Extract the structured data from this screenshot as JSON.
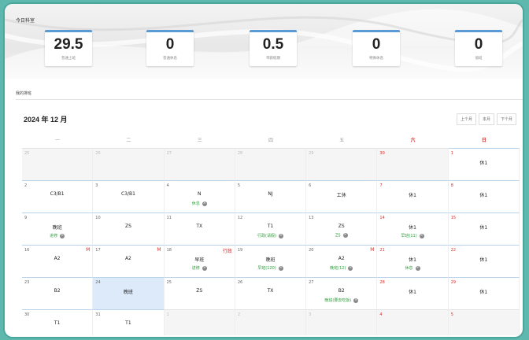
{
  "summary": {
    "title": "今日科室",
    "stats": [
      {
        "value": "29.5",
        "label": "普通上班"
      },
      {
        "value": "0",
        "label": "普通休息"
      },
      {
        "value": "0.5",
        "label": "带薪假期"
      },
      {
        "value": "0",
        "label": "特殊休息"
      },
      {
        "value": "0",
        "label": "值班"
      }
    ]
  },
  "schedule": {
    "section_label": "我的排班",
    "month_title": "2024 年 12 月",
    "nav": [
      "上个月",
      "本月",
      "下个月"
    ],
    "weekdays": [
      "一",
      "二",
      "三",
      "四",
      "五",
      "六",
      "日"
    ],
    "weeks": [
      [
        {
          "day": "25",
          "other": true
        },
        {
          "day": "26",
          "other": true
        },
        {
          "day": "27",
          "other": true
        },
        {
          "day": "28",
          "other": true
        },
        {
          "day": "29",
          "other": true
        },
        {
          "day": "30",
          "other": true,
          "weekend": true
        },
        {
          "day": "1",
          "weekend": true,
          "shift": "休1"
        }
      ],
      [
        {
          "day": "2",
          "shift": "C3/B1"
        },
        {
          "day": "3",
          "shift": "C3/B1"
        },
        {
          "day": "4",
          "shift": "N",
          "tag": "休息"
        },
        {
          "day": "5",
          "shift": "NJ"
        },
        {
          "day": "6",
          "shift": "工休"
        },
        {
          "day": "7",
          "weekend": true,
          "shift": "休1"
        },
        {
          "day": "8",
          "weekend": true,
          "shift": "休1"
        }
      ],
      [
        {
          "day": "9",
          "shift": "晚班",
          "tag": "进修"
        },
        {
          "day": "10",
          "shift": "ZS"
        },
        {
          "day": "11",
          "shift": "TX"
        },
        {
          "day": "12",
          "shift": "T1",
          "tag": "行政(请假)"
        },
        {
          "day": "13",
          "shift": "ZS",
          "tag": "ZS"
        },
        {
          "day": "14",
          "weekend": true,
          "shift": "休1",
          "tag": "早班(11)"
        },
        {
          "day": "15",
          "weekend": true,
          "shift": "休1"
        }
      ],
      [
        {
          "day": "16",
          "shift": "A2",
          "flag": "M"
        },
        {
          "day": "17",
          "shift": "A2",
          "flag": "M"
        },
        {
          "day": "18",
          "shift": "早班",
          "tag": "进修",
          "flag": "行政"
        },
        {
          "day": "19",
          "shift": "晚班",
          "tag": "早班(120)"
        },
        {
          "day": "20",
          "shift": "A2",
          "tag": "晚班(12)",
          "flag": "M"
        },
        {
          "day": "21",
          "weekend": true,
          "shift": "休1",
          "tag": "休息"
        },
        {
          "day": "22",
          "weekend": true,
          "shift": "休1"
        }
      ],
      [
        {
          "day": "23",
          "shift": "B2"
        },
        {
          "day": "24",
          "shift": "晚班",
          "today": true
        },
        {
          "day": "25",
          "shift": "ZS"
        },
        {
          "day": "26",
          "shift": "TX"
        },
        {
          "day": "27",
          "shift": "B2",
          "tag": "晚班(要去吃饭)"
        },
        {
          "day": "28",
          "weekend": true,
          "shift": "休1"
        },
        {
          "day": "29",
          "weekend": true,
          "shift": "休1"
        }
      ],
      [
        {
          "day": "30",
          "shift": "T1"
        },
        {
          "day": "31",
          "shift": "T1"
        },
        {
          "day": "1",
          "other": true
        },
        {
          "day": "2",
          "other": true
        },
        {
          "day": "3",
          "other": true
        },
        {
          "day": "4",
          "other": true,
          "weekend": true
        },
        {
          "day": "5",
          "other": true,
          "weekend": true
        }
      ]
    ]
  },
  "colors": {
    "background": "#5fb8ad",
    "accent": "#5b9bd5",
    "weekend_red": "#d9302c",
    "tag_green": "#2e9e3a",
    "today_bg": "#dceafa"
  },
  "icons": {
    "remove": "remove-circle-icon"
  }
}
